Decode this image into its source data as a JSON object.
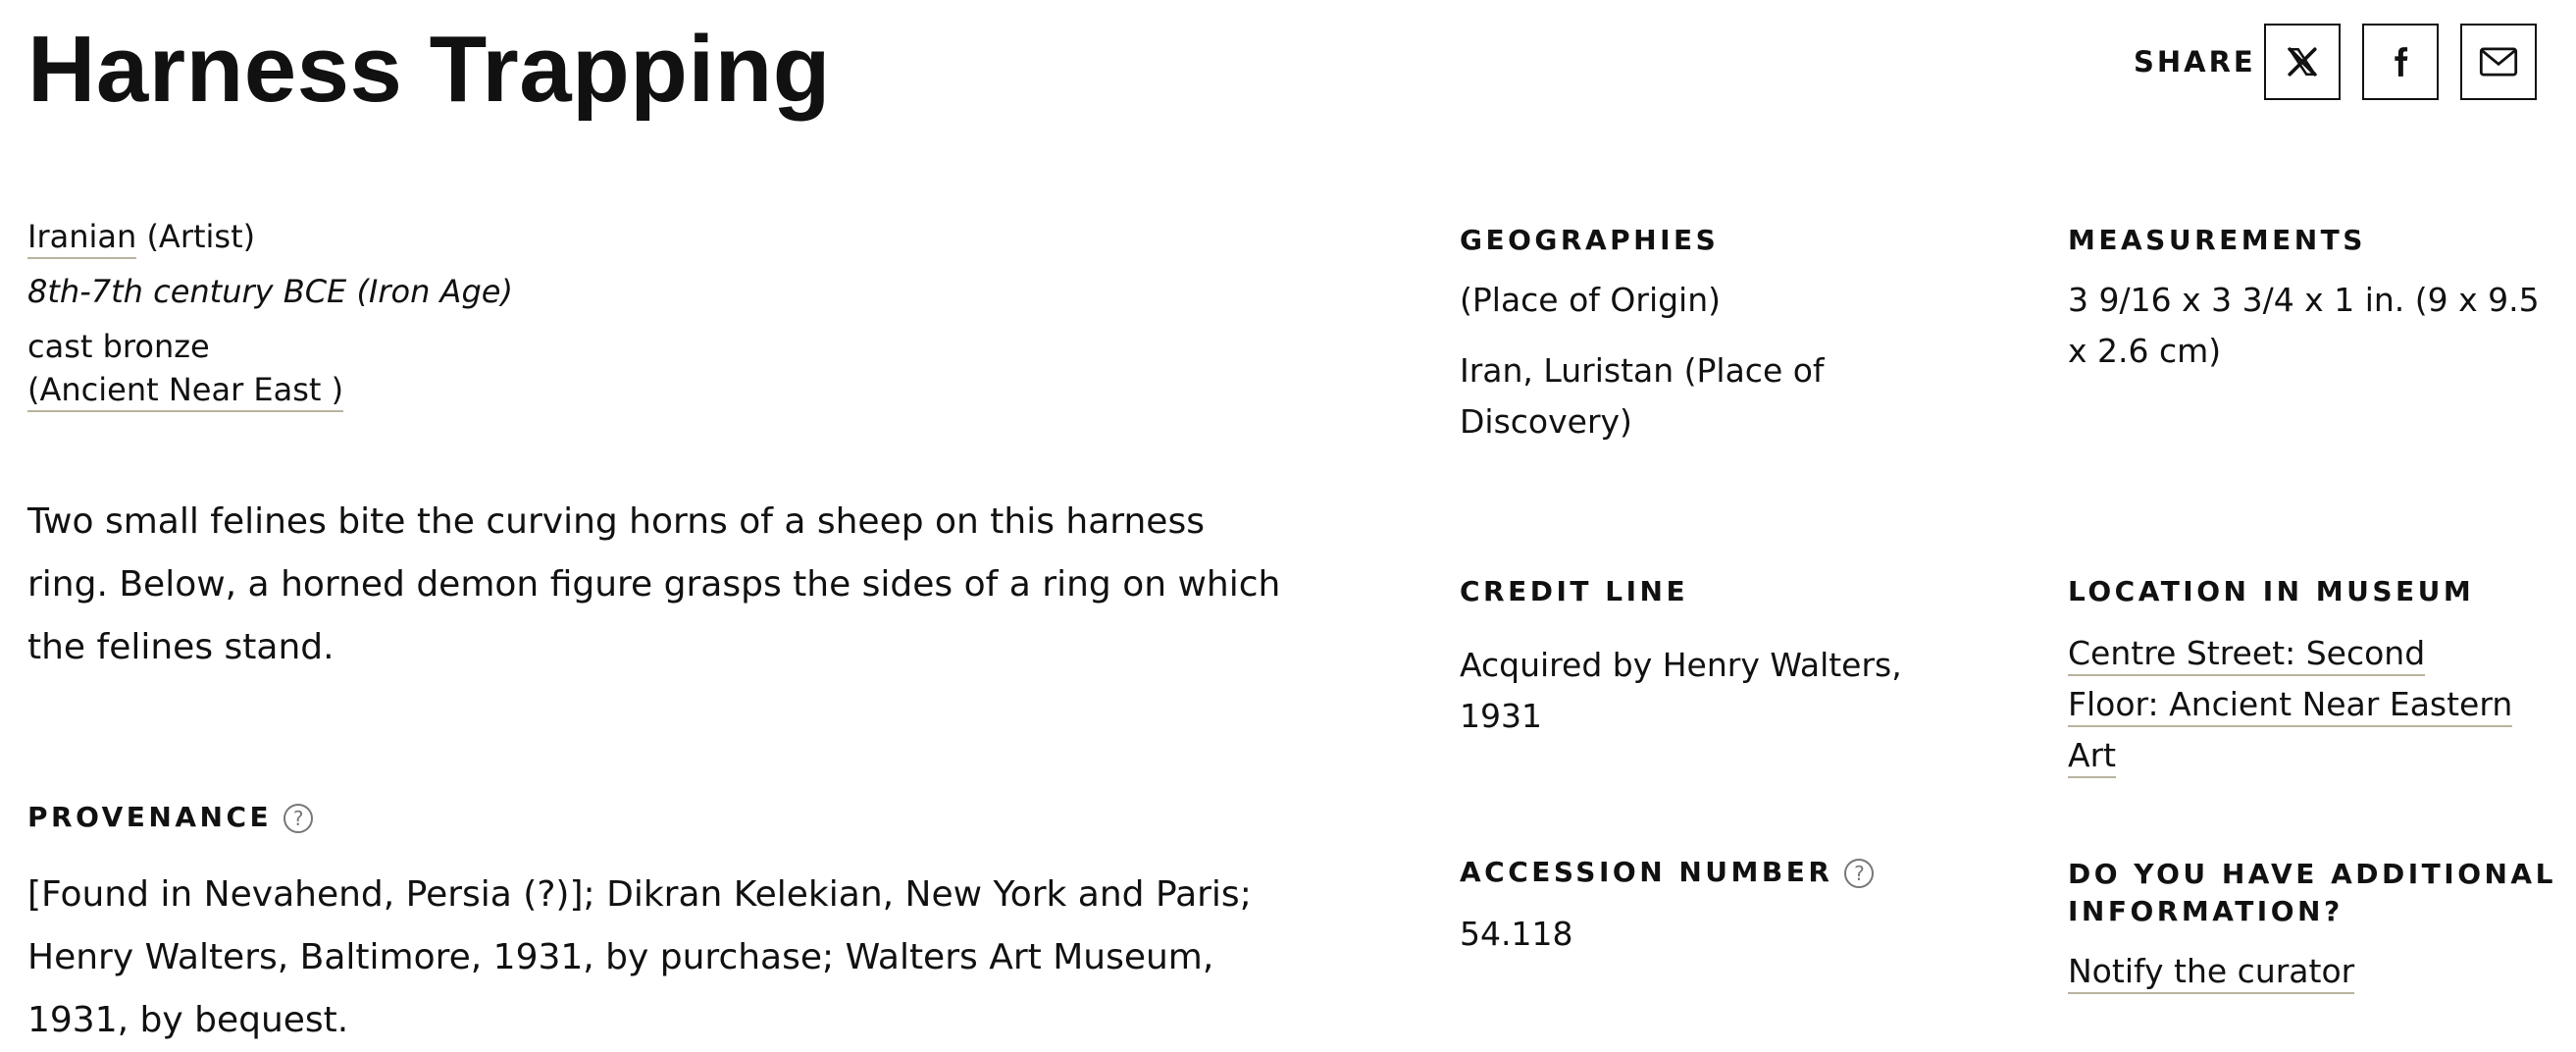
{
  "title": "Harness Trapping",
  "share": {
    "label": "SHARE",
    "buttons": [
      {
        "name": "x-share-button",
        "icon": "x-logo-icon"
      },
      {
        "name": "facebook-share-button",
        "icon": "facebook-icon"
      },
      {
        "name": "email-share-button",
        "icon": "email-icon"
      }
    ]
  },
  "artist": {
    "name": "Iranian",
    "role": "(Artist)"
  },
  "date": "8th-7th century BCE (Iron Age)",
  "medium": "cast bronze",
  "collection": "(Ancient Near East )",
  "description": "Two small felines bite the curving horns of a sheep on this harness ring. Below, a horned demon figure grasps the sides of a ring on which the felines stand.",
  "provenance": {
    "label": "PROVENANCE",
    "help": "?",
    "text": "[Found in Nevahend, Persia (?)]; Dikran Kelekian, New York and Paris; Henry Walters, Baltimore, 1931, by purchase; Walters Art Museum, 1931, by bequest."
  },
  "geographies": {
    "label": "GEOGRAPHIES",
    "items": [
      "(Place of Origin)",
      "Iran, Luristan (Place of Discovery)"
    ]
  },
  "measurements": {
    "label": "MEASUREMENTS",
    "value": "3 9/16 x 3 3/4 x 1 in. (9 x 9.5 x 2.6 cm)"
  },
  "credit_line": {
    "label": "CREDIT LINE",
    "value": "Acquired by Henry Walters, 1931"
  },
  "location": {
    "label": "LOCATION IN MUSEUM",
    "value": "Centre Street: Second Floor: Ancient Near Eastern Art"
  },
  "accession": {
    "label": "ACCESSION NUMBER",
    "help": "?",
    "value": "54.118"
  },
  "additional": {
    "label": "DO YOU HAVE ADDITIONAL INFORMATION?",
    "link": "Notify the curator"
  }
}
